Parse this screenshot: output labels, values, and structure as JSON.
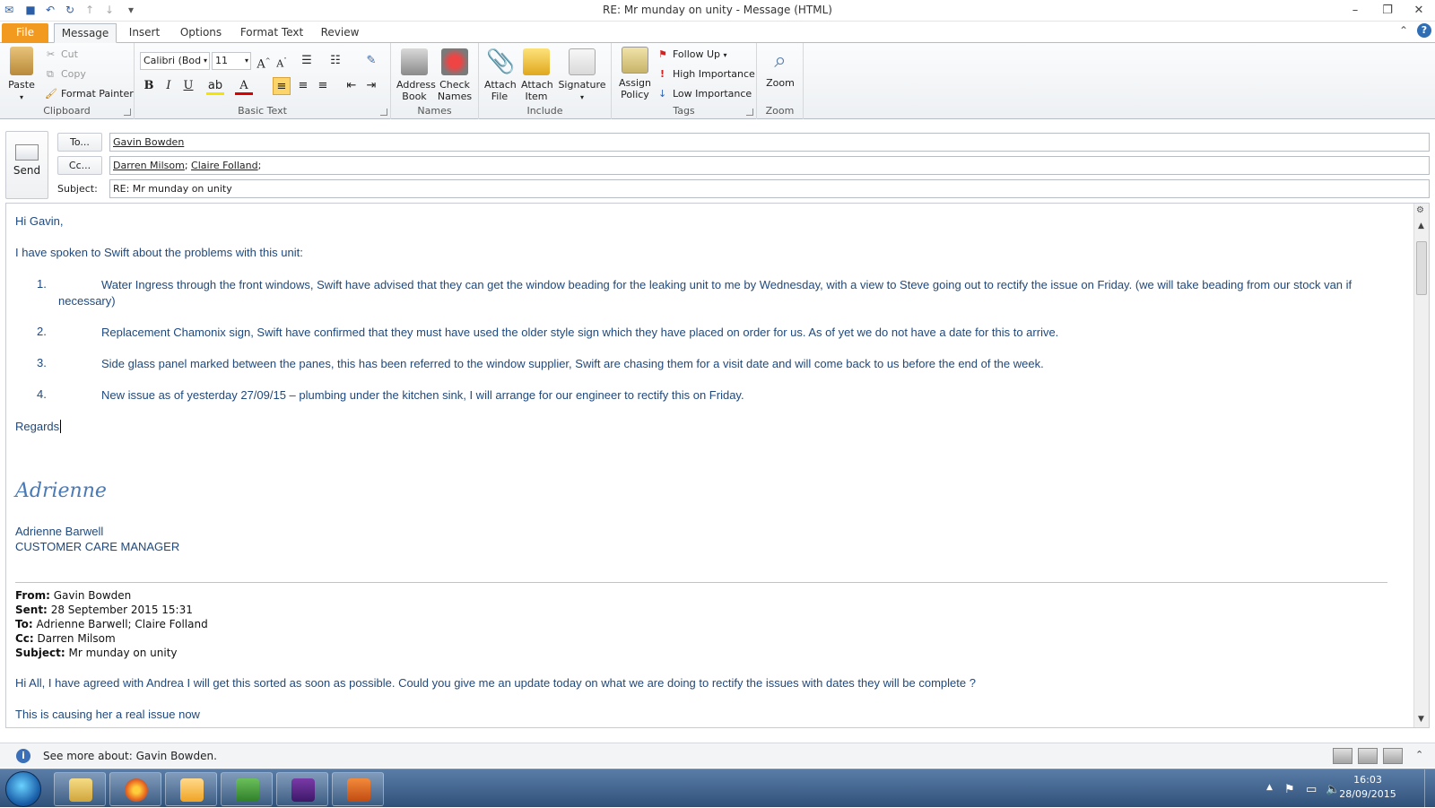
{
  "window": {
    "title": "RE: Mr munday on unity  -  Message (HTML)",
    "controls": {
      "minimize": "–",
      "restore": "❐",
      "close": "✕"
    }
  },
  "tabs": [
    "File",
    "Message",
    "Insert",
    "Options",
    "Format Text",
    "Review"
  ],
  "ribbon": {
    "clipboard": {
      "paste": "Paste",
      "cut": "Cut",
      "copy": "Copy",
      "format_painter": "Format Painter",
      "label": "Clipboard"
    },
    "basic_text": {
      "font": "Calibri (Bod",
      "size": "11",
      "label": "Basic Text"
    },
    "names": {
      "address_book": "Address Book",
      "check_names": "Check Names",
      "label": "Names"
    },
    "include": {
      "attach_file": "Attach File",
      "attach_item": "Attach Item",
      "signature": "Signature",
      "label": "Include"
    },
    "tags": {
      "assign_policy": "Assign Policy",
      "follow_up": "Follow Up",
      "high_importance": "High Importance",
      "low_importance": "Low Importance",
      "label": "Tags"
    },
    "zoom": {
      "zoom": "Zoom",
      "label": "Zoom"
    }
  },
  "header": {
    "send": "Send",
    "to_button": "To...",
    "cc_button": "Cc...",
    "subject_label": "Subject:",
    "to_value": "Gavin Bowden",
    "cc_values": [
      "Darren Milsom",
      "Claire Folland"
    ],
    "subject_value": "RE: Mr munday on unity"
  },
  "body": {
    "greeting": "Hi Gavin,",
    "intro": "I have spoken to Swift about the problems with this unit:",
    "items": [
      {
        "num": "1.",
        "text": "Water Ingress through the front windows, Swift have advised that they can get the window beading for the leaking unit to me by Wednesday, with a view to Steve going out to rectify the issue on Friday.  (we will take beading from our stock van if necessary)"
      },
      {
        "num": "2.",
        "text": "Replacement Chamonix sign, Swift have confirmed that they must have used the older style sign which they have placed on order for us.  As of yet we do not have a date for this to arrive."
      },
      {
        "num": "3.",
        "text": "Side glass panel marked between the panes, this has been referred to the window supplier, Swift are chasing them for a visit date and will come back to us before the end of the week."
      },
      {
        "num": "4.",
        "text": "New issue as of yesterday 27/09/15 – plumbing under the kitchen sink, I will arrange for our engineer to rectify this on Friday."
      }
    ],
    "closing": "Regards",
    "signature_script": "Adrienne",
    "sig_name": "Adrienne Barwell",
    "sig_title": "CUSTOMER CARE MANAGER",
    "quoted": {
      "from_label": "From:",
      "from": "Gavin Bowden",
      "sent_label": "Sent:",
      "sent": "28 September 2015 15:31",
      "to_label": "To:",
      "to": "Adrienne Barwell; Claire Folland",
      "cc_label": "Cc:",
      "cc": "Darren Milsom",
      "subject_label": "Subject:",
      "subject": "Mr munday on unity",
      "message": "Hi All, I have agreed with Andrea I will get this sorted as soon as possible. Could you give me an update today on what we are doing to rectify the issues with dates they will be complete ?",
      "message2": "This is causing her a real issue now"
    }
  },
  "infobar": {
    "text": "See more about: Gavin Bowden."
  },
  "taskbar": {
    "time": "16:03",
    "date": "28/09/2015"
  },
  "colors": {
    "file_tab": "#f29a20",
    "body_text": "#1f497d",
    "taskbar": "#2f5179"
  }
}
